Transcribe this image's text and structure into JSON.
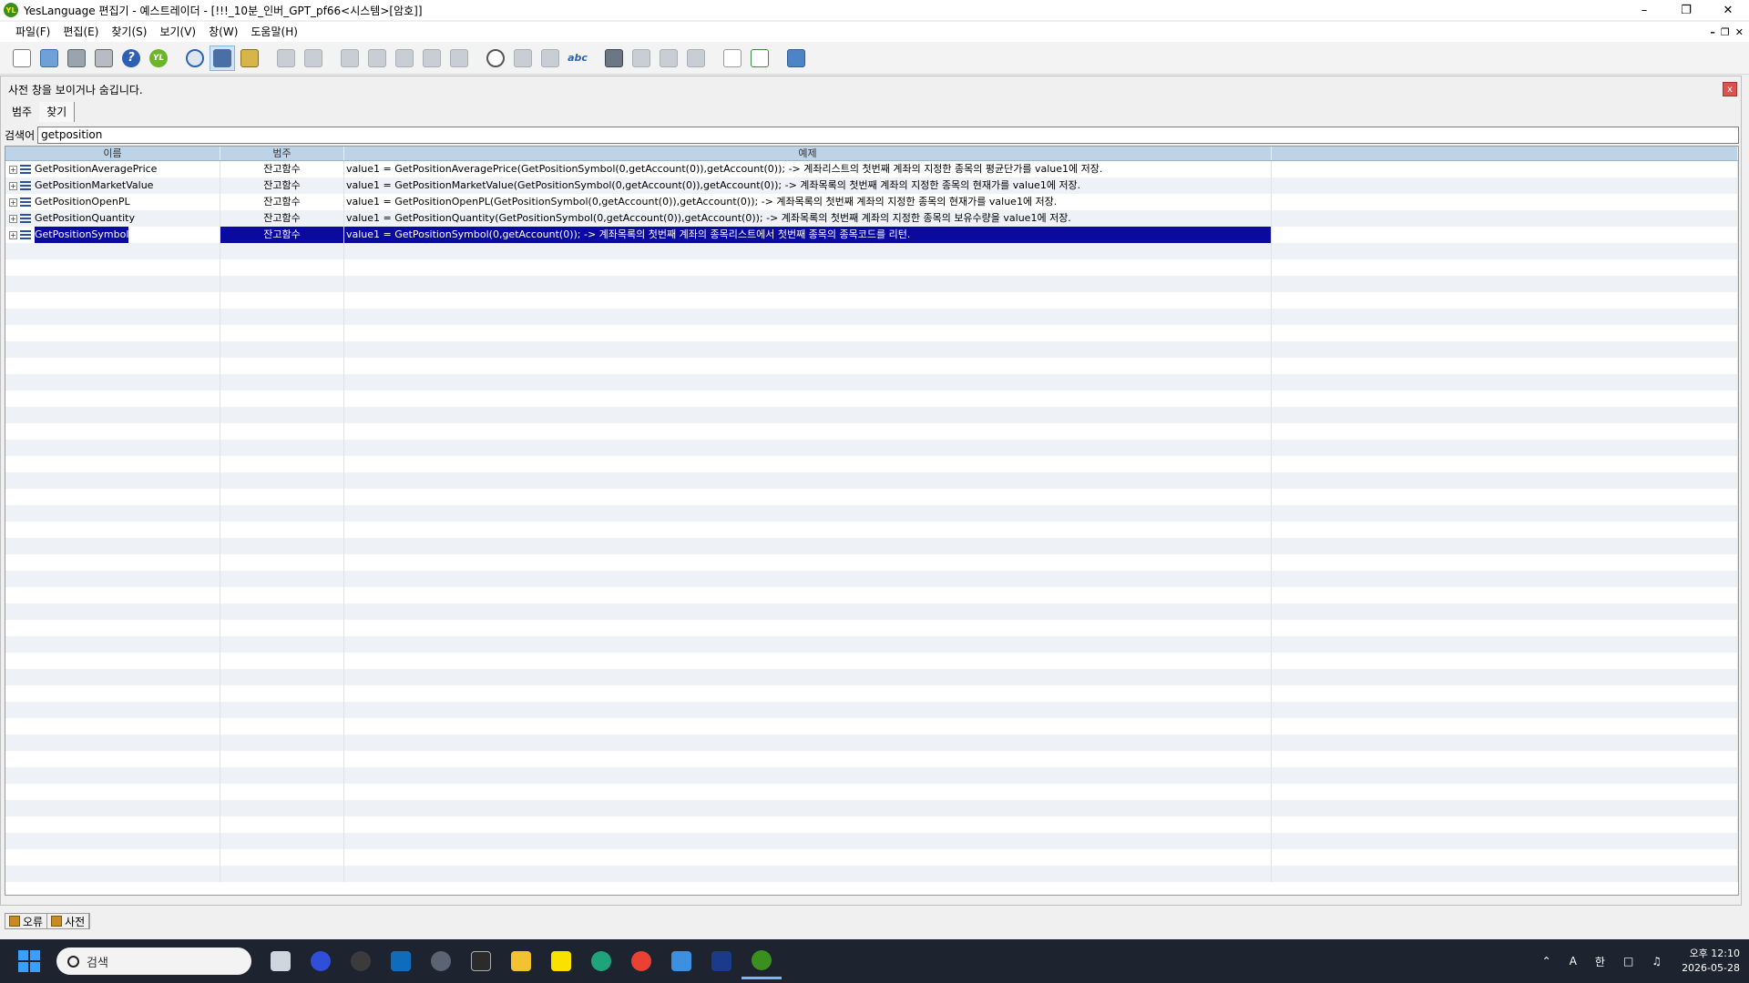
{
  "window": {
    "title": "YesLanguage 편집기 - 예스트레이더 - [!!!_10분_인버_GPT_pf66<시스템>[암호]]",
    "logo_text": "YL"
  },
  "menu": [
    "파일(F)",
    "편집(E)",
    "찾기(S)",
    "보기(V)",
    "창(W)",
    "도움말(H)"
  ],
  "toolbar": {
    "help_glyph": "?",
    "yl_glyph": "YL",
    "abc_glyph": "abc"
  },
  "dictionary": {
    "caption": "사전 창을 보이거나 숨깁니다.",
    "close_glyph": "x",
    "tabs": [
      "범주",
      "찾기"
    ],
    "search_label": "검색어",
    "search_value": "getposition",
    "columns": [
      "이름",
      "범주",
      "예제"
    ],
    "rows": [
      {
        "name": "GetPositionAveragePrice",
        "category": "잔고함수",
        "example": "value1 = GetPositionAveragePrice(GetPositionSymbol(0,getAccount(0)),getAccount(0)); -> 계좌리스트의 첫번째 계좌의 지정한 종목의 평균단가를 value1에 저장."
      },
      {
        "name": "GetPositionMarketValue",
        "category": "잔고함수",
        "example": "value1 = GetPositionMarketValue(GetPositionSymbol(0,getAccount(0)),getAccount(0)); -> 계좌목록의 첫번째 계좌의 지정한 종목의 현재가를 value1에 저장."
      },
      {
        "name": "GetPositionOpenPL",
        "category": "잔고함수",
        "example": "value1 = GetPositionOpenPL(GetPositionSymbol(0,getAccount(0)),getAccount(0)); -> 계좌목록의 첫번째 계좌의 지정한 종목의 현재가를 value1에 저장."
      },
      {
        "name": "GetPositionQuantity",
        "category": "잔고함수",
        "example": "value1 = GetPositionQuantity(GetPositionSymbol(0,getAccount(0)),getAccount(0)); -> 계좌목록의 첫번째 계좌의 지정한 종목의 보유수량을 value1에 저장."
      },
      {
        "name": "GetPositionSymbol",
        "category": "잔고함수",
        "example": "value1 = GetPositionSymbol(0,getAccount(0)); -> 계좌목록의 첫번째 계좌의 종목리스트에서 첫번째 종목의 종목코드를 리턴."
      }
    ],
    "selected_row": 4,
    "bottom_tabs": [
      "오류",
      "사전"
    ]
  },
  "taskbar": {
    "search_placeholder": "검색",
    "tray": {
      "ime1": "A",
      "ime2": "한",
      "time": "오후 12:10",
      "date": "2026-05-28"
    }
  },
  "colors": {
    "selection": "#0a0aa0",
    "header": "#bcd3e8",
    "taskbar": "#1d2430"
  }
}
